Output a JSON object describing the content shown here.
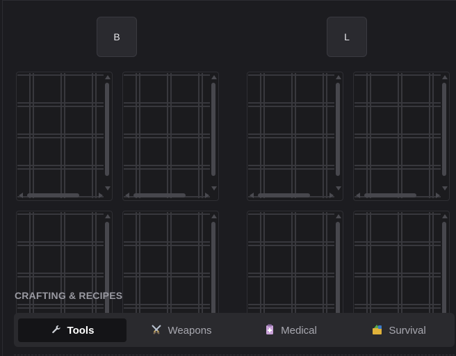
{
  "keys": {
    "left": "B",
    "right": "L"
  },
  "crafting": {
    "title": "CRAFTING & RECIPES",
    "tabs": [
      {
        "label": "Tools",
        "icon": "wrench-icon",
        "active": true
      },
      {
        "label": "Weapons",
        "icon": "crossed-swords-icon",
        "active": false
      },
      {
        "label": "Medical",
        "icon": "medical-bag-icon",
        "active": false
      },
      {
        "label": "Survival",
        "icon": "survival-kit-icon",
        "active": false
      }
    ]
  },
  "colors": {
    "background": "#1c1c20",
    "tab_active_bg": "#141417",
    "tabbar_bg": "#2a2a2e",
    "grid_line": "#38383d"
  }
}
